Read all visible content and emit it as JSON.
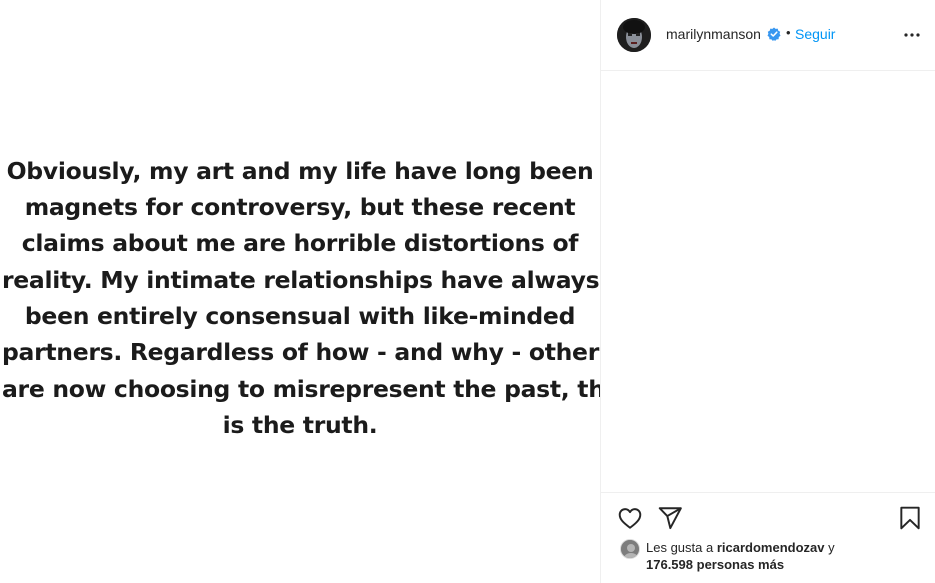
{
  "post": {
    "text_lines": [
      "Obviously, my art and my life have long been",
      "magnets for controversy, but these recent",
      "claims about me are horrible distortions of",
      "reality. My intimate relationships have always",
      "been entirely consensual with like-minded",
      "partners. Regardless of how - and why - others",
      "are now choosing to misrepresent the past, that",
      "is the truth."
    ]
  },
  "header": {
    "username": "marilynmanson",
    "verified_icon": "verified-badge-icon",
    "separator": "•",
    "follow_label": "Seguir",
    "more_icon": "more-options-icon"
  },
  "actions": {
    "like_icon": "heart-icon",
    "share_icon": "paper-plane-icon",
    "save_icon": "bookmark-icon"
  },
  "likes": {
    "prefix": "Les gusta a",
    "liker": "ricardomendozav",
    "conjunction": "y",
    "count": "176.598",
    "suffix": "personas más"
  },
  "colors": {
    "accent": "#0095f6",
    "text": "#262626",
    "border": "#efefef",
    "verified": "#3897f0"
  }
}
